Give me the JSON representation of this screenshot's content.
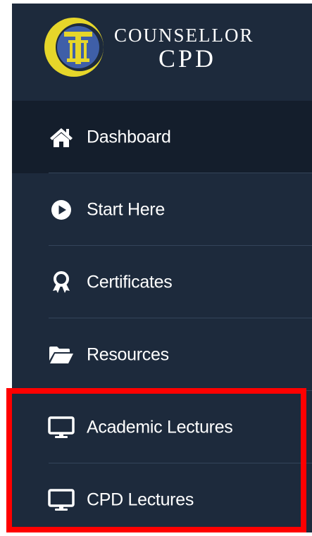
{
  "brand": {
    "line1": "COUNSELLOR",
    "line2": "CPD"
  },
  "nav": {
    "items": [
      {
        "label": "Dashboard",
        "icon": "home-icon",
        "active": true
      },
      {
        "label": "Start Here",
        "icon": "play-circle-icon",
        "active": false
      },
      {
        "label": "Certificates",
        "icon": "award-icon",
        "active": false
      },
      {
        "label": "Resources",
        "icon": "folder-open-icon",
        "active": false
      },
      {
        "label": "Academic Lectures",
        "icon": "desktop-icon",
        "active": false
      },
      {
        "label": "CPD Lectures",
        "icon": "desktop-icon",
        "active": false
      }
    ]
  },
  "colors": {
    "sidebar_bg": "#1d2a3c",
    "active_bg": "#141e2c",
    "divider": "#34445a",
    "text": "#ffffff",
    "logo_gold": "#e6d62a",
    "logo_blue": "#3f5fa8",
    "highlight": "#ff0000"
  }
}
